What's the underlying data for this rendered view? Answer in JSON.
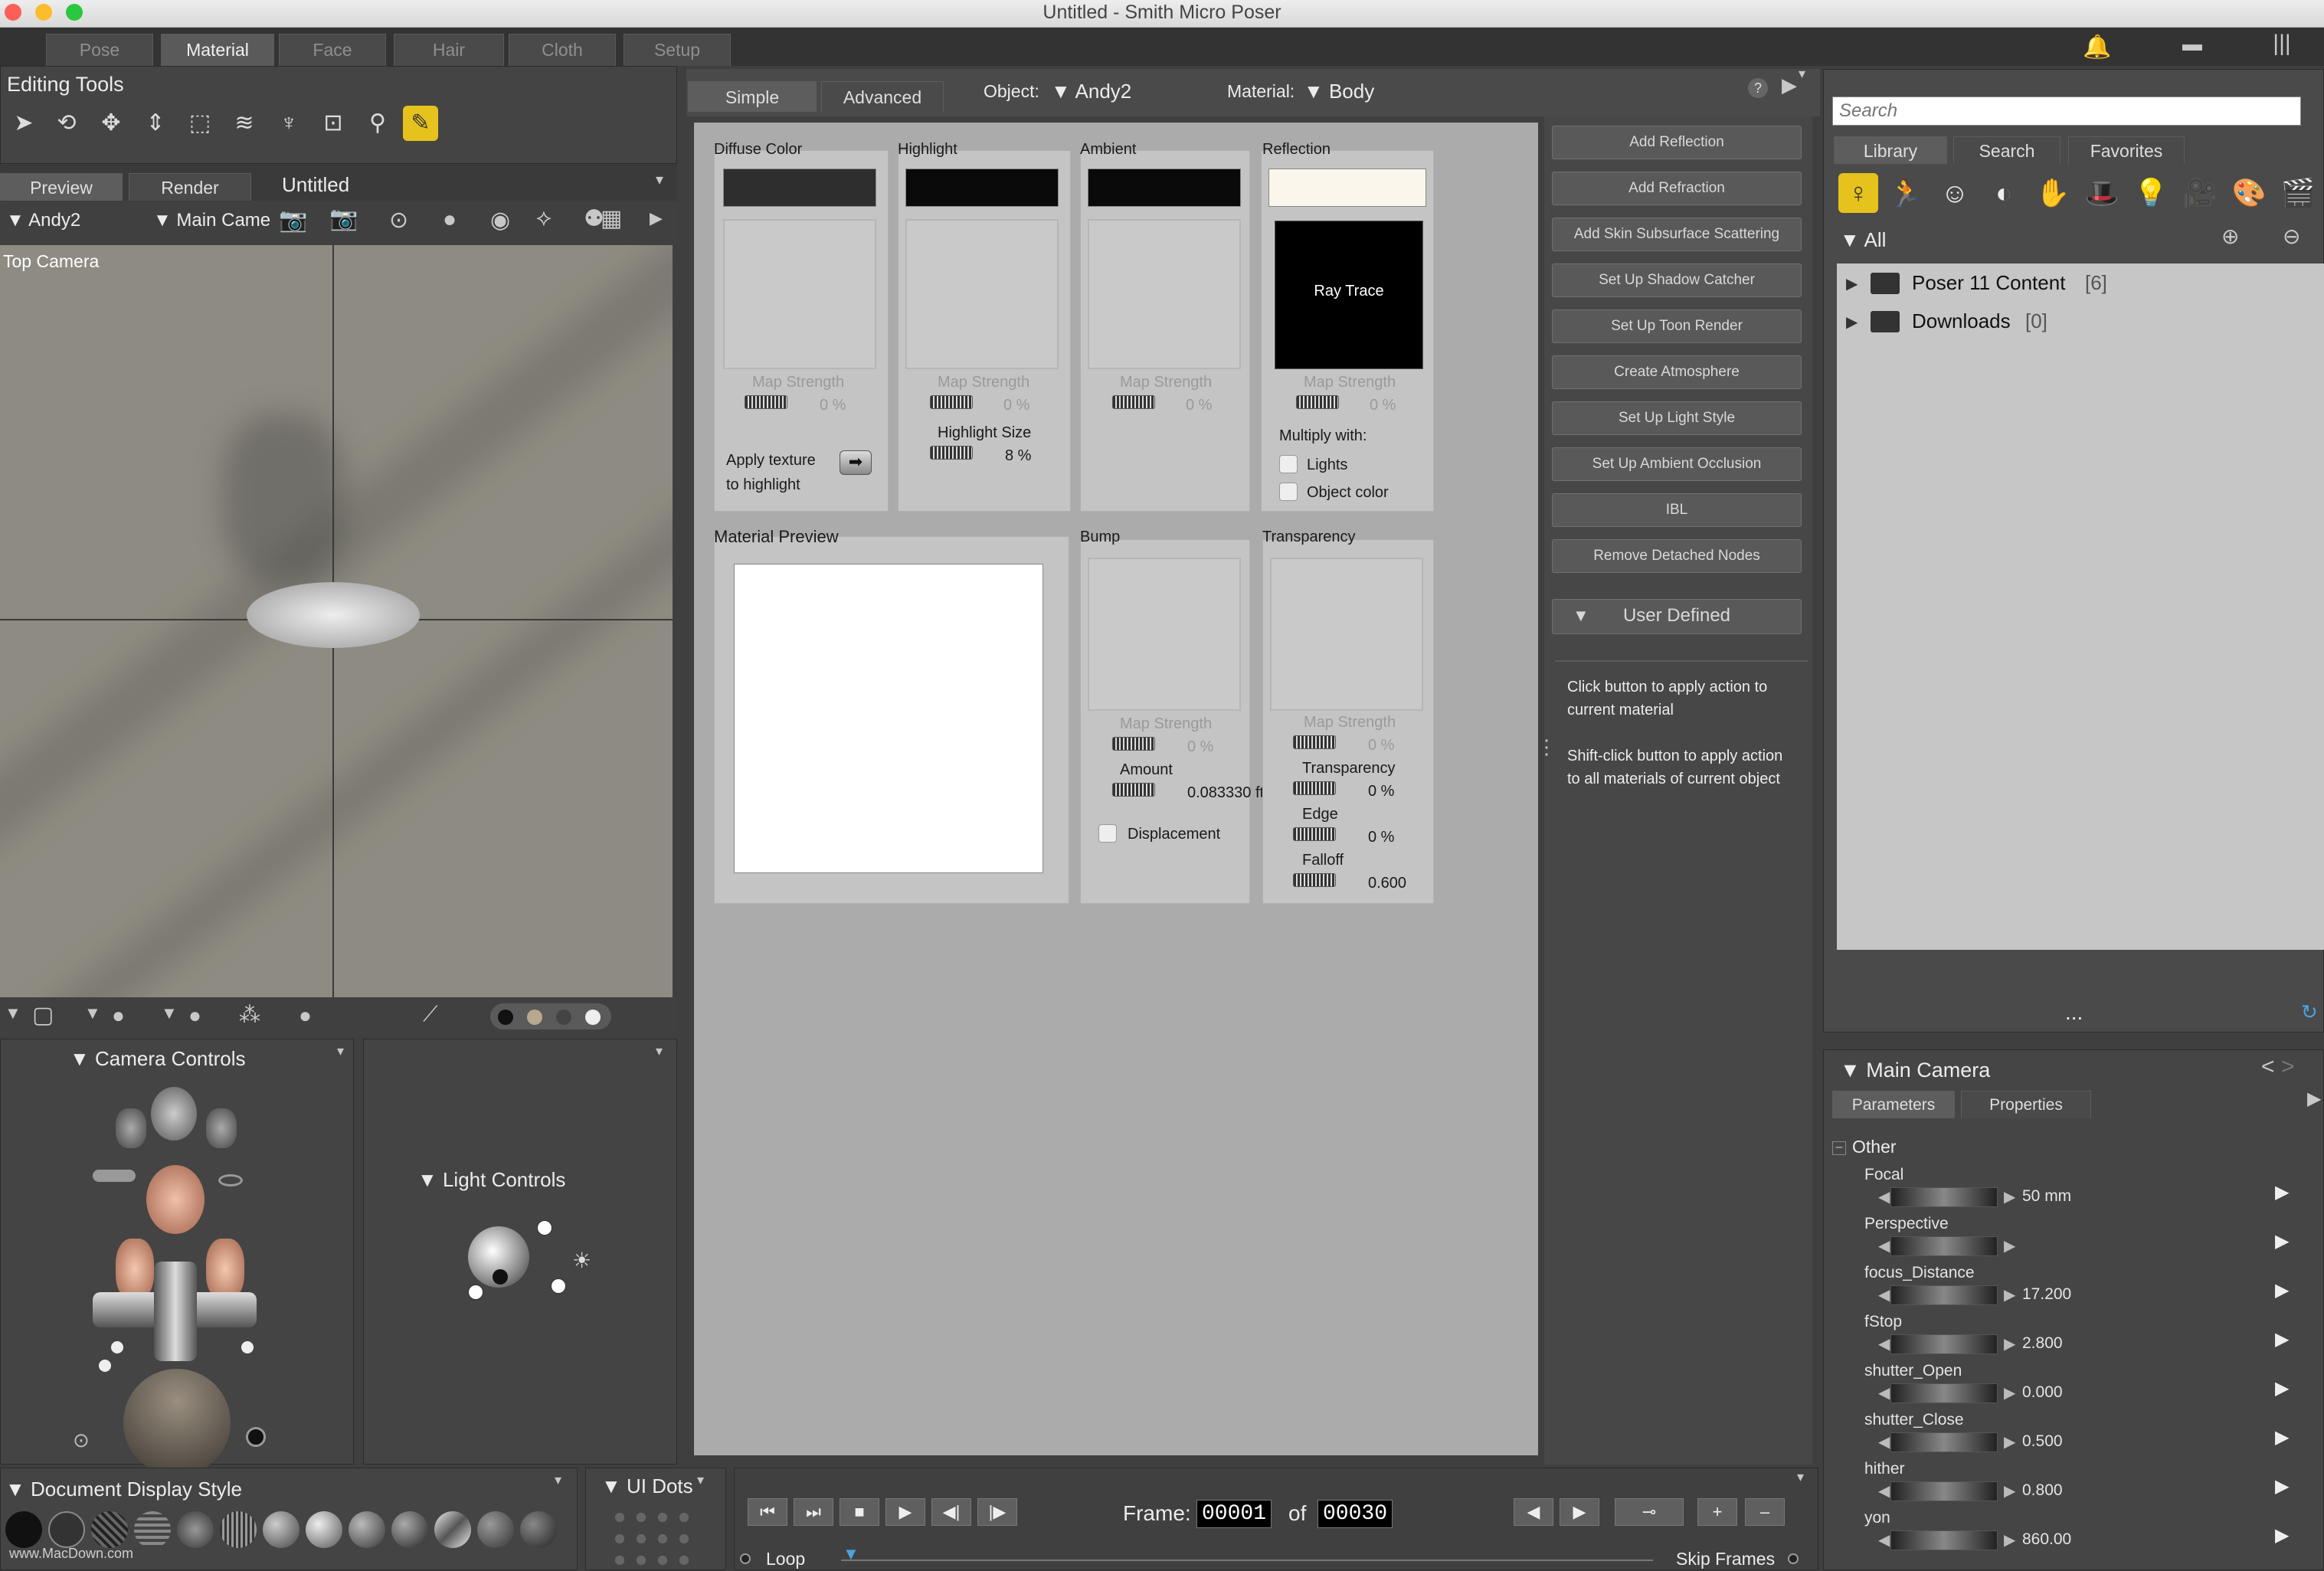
{
  "app": {
    "window_title": "Untitled - Smith Micro Poser"
  },
  "rooms": [
    "Pose",
    "Material",
    "Face",
    "Hair",
    "Cloth",
    "Setup"
  ],
  "left": {
    "editing_tools_title": "Editing Tools",
    "tools": [
      "select-arrow-icon",
      "rotate-icon",
      "translate-icon",
      "translate-in-out-icon",
      "scale-icon",
      "taper-icon",
      "twist-icon",
      "direct-manipulation-icon",
      "zoom-icon",
      "eyedropper-icon"
    ],
    "view_tabs": [
      "Preview",
      "Render"
    ],
    "doc_title": "Untitled",
    "figure_select": "Andy2",
    "camera_select": "Main Came",
    "viewport_label": "Top Camera",
    "camera_controls_title": "Camera Controls",
    "light_controls_title": "Light Controls",
    "document_display_title": "Document Display Style",
    "ui_dots_title": "UI Dots",
    "watermark": "www.MacDown.com"
  },
  "material_room": {
    "tabs": [
      "Simple",
      "Advanced"
    ],
    "object_label": "Object:",
    "object_value": "Andy2",
    "material_label": "Material:",
    "material_value": "Body",
    "diffuse": {
      "title": "Diffuse Color",
      "map_strength": "Map Strength",
      "pct": "0 %",
      "swatch_color": "#2e2e2e",
      "apply_texture": "Apply texture",
      "to_highlight": "to highlight"
    },
    "highlight": {
      "title": "Highlight",
      "map_strength": "Map Strength",
      "pct": "0 %",
      "size_label": "Highlight Size",
      "size_value": "8 %",
      "swatch_color": "#0a0a0a"
    },
    "ambient": {
      "title": "Ambient",
      "map_strength": "Map Strength",
      "pct": "0 %",
      "swatch_color": "#0a0a0a"
    },
    "reflection": {
      "title": "Reflection",
      "ray_trace": "Ray Trace",
      "map_strength": "Map Strength",
      "pct": "0 %",
      "multiply_with": "Multiply with:",
      "lights": "Lights",
      "object_color": "Object color",
      "swatch_color": "#fbf6ec"
    },
    "preview": {
      "title": "Material Preview"
    },
    "bump": {
      "title": "Bump",
      "map_strength": "Map Strength",
      "pct": "0 %",
      "amount_label": "Amount",
      "amount_value": "0.083330 ft",
      "displacement": "Displacement"
    },
    "transparency": {
      "title": "Transparency",
      "map_strength": "Map Strength",
      "pct": "0 %",
      "trans_label": "Transparency",
      "trans_value": "0 %",
      "edge_label": "Edge",
      "edge_value": "0 %",
      "falloff_label": "Falloff",
      "falloff_value": "0.600"
    }
  },
  "wizard": {
    "buttons": [
      "Add Reflection",
      "Add Refraction",
      "Add Skin Subsurface Scattering",
      "Set Up Shadow Catcher",
      "Set Up Toon Render",
      "Create Atmosphere",
      "Set Up Light Style",
      "Set Up Ambient Occlusion",
      "IBL",
      "Remove Detached Nodes"
    ],
    "user_defined": "User Defined",
    "help1": "Click button to apply action to current material",
    "help2": "Shift-click button to apply action to all materials of current object"
  },
  "library": {
    "search_placeholder": "Search",
    "tabs": [
      "Library",
      "Search",
      "Favorites"
    ],
    "category": "All",
    "items": [
      {
        "name": "Poser 11 Content",
        "count": "[6]"
      },
      {
        "name": "Downloads",
        "count": "[0]"
      }
    ],
    "more": "..."
  },
  "params": {
    "title": "Main Camera",
    "tabs": [
      "Parameters",
      "Properties"
    ],
    "group": "Other",
    "rows": [
      {
        "name": "Focal",
        "value": "50 mm"
      },
      {
        "name": "Perspective",
        "value": ""
      },
      {
        "name": "focus_Distance",
        "value": "17.200"
      },
      {
        "name": "fStop",
        "value": "2.800"
      },
      {
        "name": "shutter_Open",
        "value": "0.000"
      },
      {
        "name": "shutter_Close",
        "value": "0.500"
      },
      {
        "name": "hither",
        "value": "0.800"
      },
      {
        "name": "yon",
        "value": "860.00"
      }
    ]
  },
  "timeline": {
    "frame_label": "Frame:",
    "frame_current": "00001",
    "of_label": "of",
    "frame_total": "00030",
    "loop": "Loop",
    "skip_frames": "Skip Frames"
  }
}
